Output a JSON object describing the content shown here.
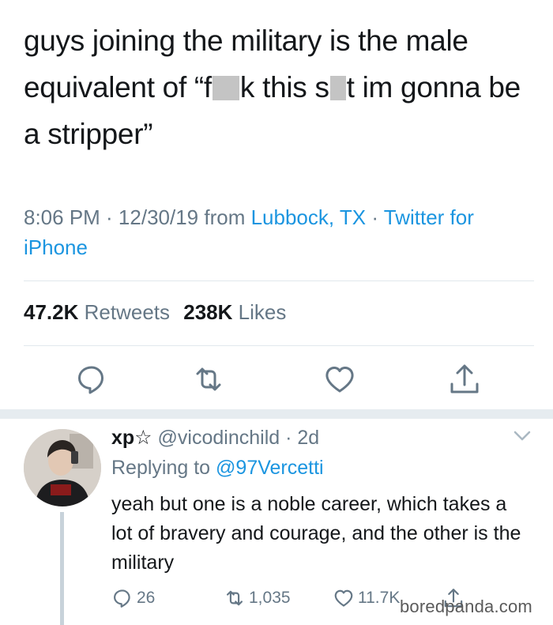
{
  "tweet": {
    "text_part1": "guys joining the military is the male equivalent of “f",
    "text_part2": "k this s",
    "text_part3": "t im gonna be a stripper”",
    "time": "8:06 PM · 12/30/19 from ",
    "location": "Lubbock, TX",
    "separator": " · ",
    "client": "Twitter for iPhone"
  },
  "stats": {
    "retweets_count": "47.2K",
    "retweets_label": "Retweets",
    "likes_count": "238K",
    "likes_label": "Likes"
  },
  "actions": {
    "icons": [
      "reply-icon",
      "retweet-icon",
      "like-icon",
      "share-icon"
    ]
  },
  "reply": {
    "name": "xp☆",
    "handle": "@vicodinchild",
    "dot": "·",
    "time": "2d",
    "replying_prefix": "Replying to ",
    "replying_to": "@97Vercetti",
    "text": "yeah but one is a noble career, which takes a lot of bravery and courage, and the other is the military",
    "replies": "26",
    "retweets": "1,035",
    "likes": "11.7K"
  },
  "watermark": "boredpanda.com",
  "colors": {
    "text": "#14171a",
    "secondary": "#657786",
    "link": "#1b95e0",
    "divider": "#e1e8ed"
  }
}
